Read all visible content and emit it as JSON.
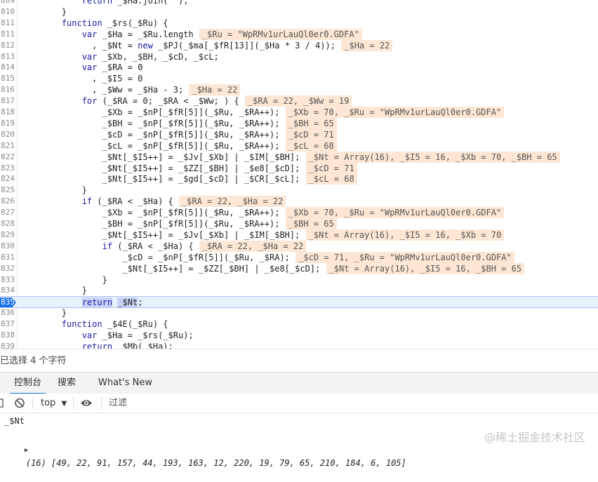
{
  "editor": {
    "lines": [
      {
        "n": "809",
        "code": "            return _$Ha.join(\"\");",
        "indent": 0,
        "ann": ""
      },
      {
        "n": "810",
        "code": "        }",
        "indent": 0,
        "ann": ""
      },
      {
        "n": "811",
        "code": "        function _$rs(_$Ru) {",
        "indent": 0,
        "ann": ""
      },
      {
        "n": "811",
        "code": "            var _$Ha = _$Ru.length",
        "indent": 0,
        "ann": "_$Ru = \"WpRMv1urLauQl0er0.GDFA\""
      },
      {
        "n": "812",
        "code": "              , _$Nt = new _$PJ(_$ma[_$fR[13]](_$Ha * 3 / 4));",
        "indent": 0,
        "ann": "_$Ha = 22"
      },
      {
        "n": "813",
        "code": "            var _$Xb, _$BH, _$cD, _$cL;",
        "indent": 0,
        "ann": ""
      },
      {
        "n": "814",
        "code": "            var _$RA = 0",
        "indent": 0,
        "ann": ""
      },
      {
        "n": "815",
        "code": "              , _$I5 = 0",
        "indent": 0,
        "ann": ""
      },
      {
        "n": "816",
        "code": "              , _$Ww = _$Ha - 3;",
        "indent": 0,
        "ann": "_$Ha = 22"
      },
      {
        "n": "817",
        "code": "            for (_$RA = 0; _$RA < _$Ww; ) {",
        "indent": 0,
        "ann": "_$RA = 22, _$Ww = 19"
      },
      {
        "n": "818",
        "code": "                _$Xb = _$nP[_$fR[5]](_$Ru, _$RA++);",
        "indent": 0,
        "ann": "_$Xb = 70, _$Ru = \"WpRMv1urLauQl0er0.GDFA\""
      },
      {
        "n": "819",
        "code": "                _$BH = _$nP[_$fR[5]](_$Ru, _$RA++);",
        "indent": 0,
        "ann": "_$BH = 65"
      },
      {
        "n": "820",
        "code": "                _$cD = _$nP[_$fR[5]](_$Ru, _$RA++);",
        "indent": 0,
        "ann": "_$cD = 71"
      },
      {
        "n": "821",
        "code": "                _$cL = _$nP[_$fR[5]](_$Ru, _$RA++);",
        "indent": 0,
        "ann": "_$cL = 68"
      },
      {
        "n": "822",
        "code": "                _$Nt[_$I5++] = _$Jv[_$Xb] | _$IM[_$BH];",
        "indent": 0,
        "ann": "_$Nt = Array(16), _$I5 = 16, _$Xb = 70, _$BH = 65"
      },
      {
        "n": "823",
        "code": "                _$Nt[_$I5++] = _$ZZ[_$BH] | _$e8[_$cD];",
        "indent": 0,
        "ann": "_$cD = 71"
      },
      {
        "n": "824",
        "code": "                _$Nt[_$I5++] = _$gd[_$cD] | _$CR[_$cL];",
        "indent": 0,
        "ann": "_$cL = 68"
      },
      {
        "n": "825",
        "code": "            }",
        "indent": 0,
        "ann": ""
      },
      {
        "n": "826",
        "code": "            if (_$RA < _$Ha) {",
        "indent": 0,
        "ann": "_$RA = 22, _$Ha = 22"
      },
      {
        "n": "827",
        "code": "                _$Xb = _$nP[_$fR[5]](_$Ru, _$RA++);",
        "indent": 0,
        "ann": "_$Xb = 70, _$Ru = \"WpRMv1urLauQl0er0.GDFA\""
      },
      {
        "n": "828",
        "code": "                _$BH = _$nP[_$fR[5]](_$Ru, _$RA++);",
        "indent": 0,
        "ann": "_$BH = 65"
      },
      {
        "n": "829",
        "code": "                _$Nt[_$I5++] = _$Jv[_$Xb] | _$IM[_$BH];",
        "indent": 0,
        "ann": "_$Nt = Array(16), _$I5 = 16, _$Xb = 70"
      },
      {
        "n": "830",
        "code": "                if (_$RA < _$Ha) {",
        "indent": 0,
        "ann": "_$RA = 22, _$Ha = 22"
      },
      {
        "n": "831",
        "code": "                    _$cD = _$nP[_$fR[5]](_$Ru, _$RA);",
        "indent": 0,
        "ann": "_$cD = 71, _$Ru = \"WpRMv1urLauQl0er0.GDFA\""
      },
      {
        "n": "832",
        "code": "                    _$Nt[_$I5++] = _$ZZ[_$BH] | _$e8[_$cD];",
        "indent": 0,
        "ann": "_$Nt = Array(16), _$I5 = 16, _$BH = 65"
      },
      {
        "n": "833",
        "code": "                }",
        "indent": 0,
        "ann": ""
      },
      {
        "n": "834",
        "code": "            }",
        "indent": 0,
        "ann": ""
      },
      {
        "n": "835",
        "code": "            return _$Nt;",
        "indent": 0,
        "ann": "",
        "current": true
      },
      {
        "n": "836",
        "code": "        }",
        "indent": 0,
        "ann": ""
      },
      {
        "n": "837",
        "code": "        function _$4E(_$Ru) {",
        "indent": 0,
        "ann": ""
      },
      {
        "n": "838",
        "code": "            var _$Ha = _$rs(_$Ru);",
        "indent": 0,
        "ann": ""
      },
      {
        "n": "839",
        "code": "            return _$Mb(_$Ha);",
        "indent": 0,
        "ann": ""
      }
    ]
  },
  "status": {
    "selection": "已选择 4 个字符"
  },
  "drawer": {
    "tabs": [
      {
        "label": "控制台"
      },
      {
        "label": "搜索"
      },
      {
        "label": "What's New"
      }
    ]
  },
  "toolbar": {
    "context": "top",
    "filter_placeholder": "过滤"
  },
  "console": {
    "input": "_$Nt",
    "output": "(16) [49, 22, 91, 157, 44, 193, 163, 12, 220, 19, 79, 65, 210, 184, 6, 105]"
  },
  "watermark": "@稀土掘金技术社区",
  "colors": {
    "keyword": "#1a1aa6",
    "highlight": "#fde6d3",
    "accent": "#1a73e8"
  }
}
